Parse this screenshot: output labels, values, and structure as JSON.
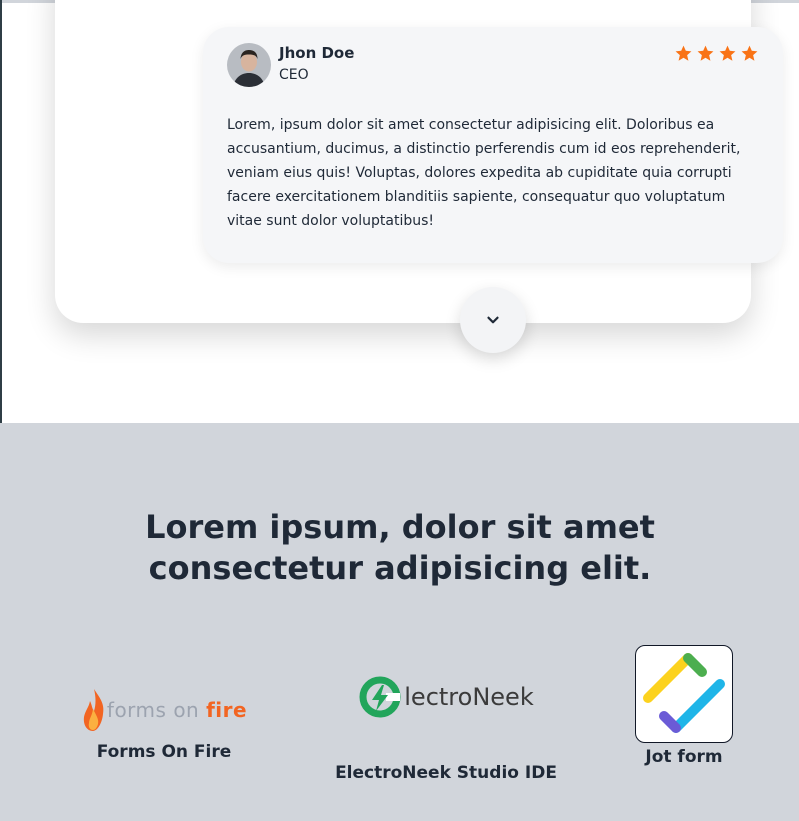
{
  "review": {
    "name": "Jhon Doe",
    "role": "CEO",
    "rating": 4,
    "text": "Lorem, ipsum dolor sit amet consectetur adipisicing elit. Doloribus ea accusantium, ducimus, a distinctio perferendis cum id eos reprehenderit, veniam eius quis! Voluptas, dolores expedita ab cupiditate quia corrupti facere exercitationem blanditiis sapiente, consequatur quo voluptatum vitae sunt dolor voluptatibus!",
    "star_color": "#f97316"
  },
  "expand_icon": "chevron-down-icon",
  "integrations": {
    "title": "Lorem ipsum, dolor sit amet consectetur adipisicing elit.",
    "background": "#d1d5db",
    "partners": [
      {
        "label": "Forms On Fire",
        "logo_text_a": "forms on ",
        "logo_text_b": "fire"
      },
      {
        "label": "ElectroNeek Studio IDE",
        "logo_text": "lectroNeek"
      },
      {
        "label": "Jot form"
      }
    ]
  }
}
